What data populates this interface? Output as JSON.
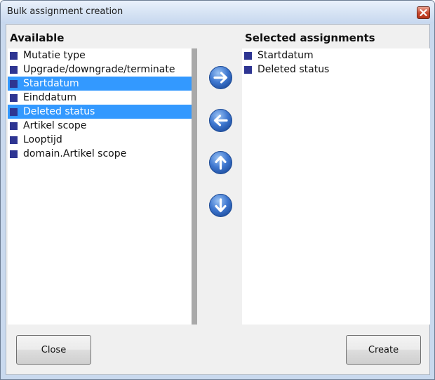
{
  "window": {
    "title": "Bulk assignment creation"
  },
  "available": {
    "header": "Available",
    "items": [
      {
        "label": "Mutatie type",
        "selected": false
      },
      {
        "label": "Upgrade/downgrade/terminate",
        "selected": false
      },
      {
        "label": "Startdatum",
        "selected": true
      },
      {
        "label": "Einddatum",
        "selected": false
      },
      {
        "label": "Deleted status",
        "selected": true
      },
      {
        "label": "Artikel scope",
        "selected": false
      },
      {
        "label": "Looptijd",
        "selected": false
      },
      {
        "label": "domain.Artikel scope",
        "selected": false
      }
    ]
  },
  "selected": {
    "header": "Selected assignments",
    "items": [
      {
        "label": "Startdatum"
      },
      {
        "label": "Deleted status"
      }
    ]
  },
  "controls": {
    "icons": [
      "arrow-right-icon",
      "arrow-left-icon",
      "arrow-up-icon",
      "arrow-down-icon"
    ]
  },
  "buttons": {
    "close": "Close",
    "create": "Create"
  },
  "colors": {
    "selection": "#3399ff",
    "item_square": "#2e3592",
    "arrow_button": "#3f78d0",
    "close_button": "#c8462c"
  }
}
